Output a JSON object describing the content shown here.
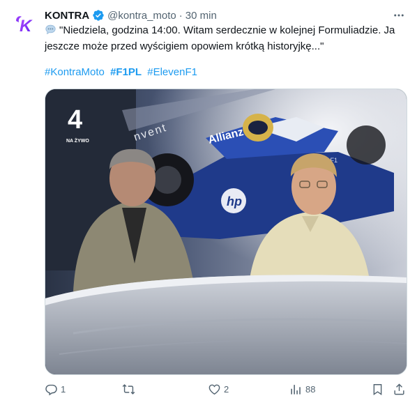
{
  "tweet": {
    "author_name": "KONTRA",
    "author_handle": "@kontra_moto",
    "separator": "·",
    "time": "30 min",
    "text_line1": "\"Niedziela, godzina 14:00. Witam serdecznie w kolejnej Formuliadzie. Ja",
    "text_line2": "jeszcze może przed wyścigiem opowiem krótką historyjkę...\"",
    "hashtags": [
      "#KontraMoto",
      "#F1PL",
      "#ElevenF1"
    ],
    "media": {
      "channel_number": "4",
      "live_label": "NA ŻYWO",
      "banner_text": "nvent",
      "car_sponsors": [
        "Allianz",
        "hp",
        "WilliamsF1"
      ]
    },
    "actions": {
      "reply_count": "1",
      "retweet_count": "",
      "like_count": "2",
      "views_count": "88"
    }
  },
  "icons": {
    "avatar": "kontra-logo",
    "verified": "verified-badge-icon",
    "more": "more-icon",
    "speech": "speech-balloon-icon",
    "reply": "reply-icon",
    "retweet": "retweet-icon",
    "like": "like-icon",
    "views": "views-icon",
    "bookmark": "bookmark-icon",
    "share": "share-icon"
  },
  "colors": {
    "accent": "#1d9bf0",
    "secondary_text": "#536471",
    "logo_purple": "#7b2ff7"
  }
}
